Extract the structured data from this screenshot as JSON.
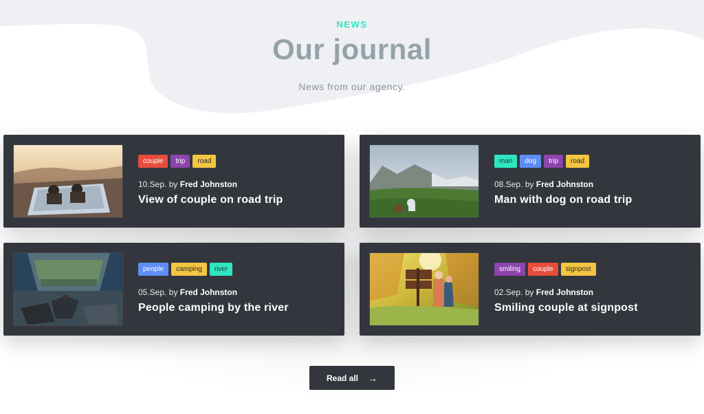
{
  "header": {
    "eyebrow": "NEWS",
    "title": "Our journal",
    "subtitle": "News from our agency."
  },
  "tag_colors": {
    "red": "#e74c3c",
    "purple": "#8e44ad",
    "yellow": "#f4c542",
    "teal": "#2ee6c1",
    "blue": "#5d8df5"
  },
  "cards": [
    {
      "date": "10.Sep.",
      "by": "by",
      "author": "Fred Johnston",
      "title": "View of couple on road trip",
      "tags": [
        {
          "label": "couple",
          "color": "red"
        },
        {
          "label": "trip",
          "color": "purple"
        },
        {
          "label": "road",
          "color": "yellow"
        }
      ]
    },
    {
      "date": "08.Sep.",
      "by": "by",
      "author": "Fred Johnston",
      "title": "Man with dog on road trip",
      "tags": [
        {
          "label": "man",
          "color": "teal"
        },
        {
          "label": "dog",
          "color": "blue"
        },
        {
          "label": "trip",
          "color": "purple"
        },
        {
          "label": "road",
          "color": "yellow"
        }
      ]
    },
    {
      "date": "05.Sep.",
      "by": "by",
      "author": "Fred Johnston",
      "title": "People camping by the river",
      "tags": [
        {
          "label": "people",
          "color": "blue"
        },
        {
          "label": "camping",
          "color": "yellow"
        },
        {
          "label": "river",
          "color": "teal"
        }
      ]
    },
    {
      "date": "02.Sep.",
      "by": "by",
      "author": "Fred Johnston",
      "title": "Smiling couple at signpost",
      "tags": [
        {
          "label": "smiling",
          "color": "purple"
        },
        {
          "label": "couple",
          "color": "red"
        },
        {
          "label": "signpost",
          "color": "yellow"
        }
      ]
    }
  ],
  "read_all": {
    "label": "Read all",
    "icon": "arrow-right-icon"
  }
}
